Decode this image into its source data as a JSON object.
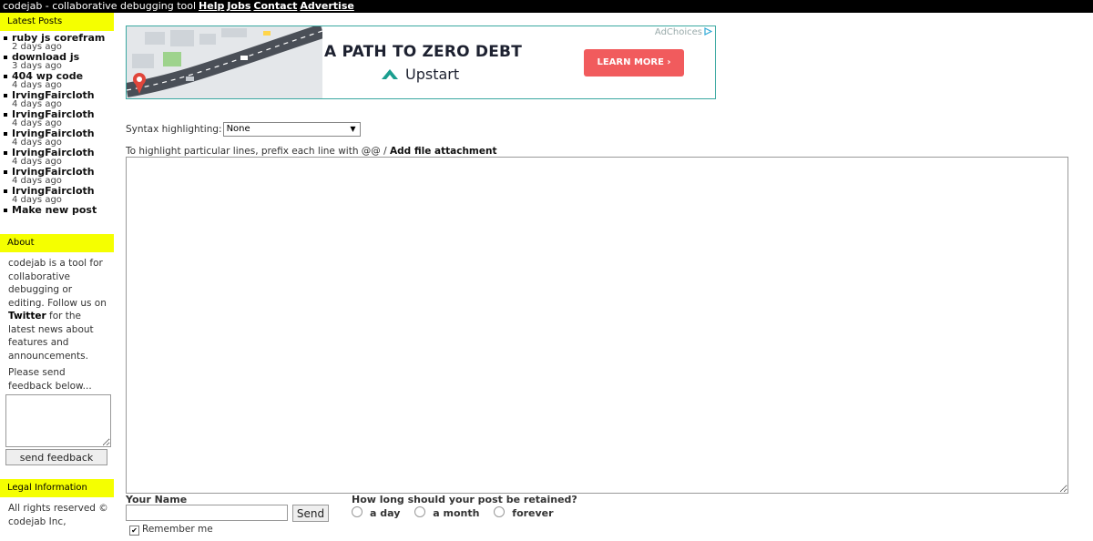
{
  "topbar": {
    "site_title": "codejab - collaborative debugging tool",
    "nav": [
      "Help",
      "Jobs",
      "Contact",
      "Advertise"
    ]
  },
  "sidebar": {
    "latest_heading": "Latest Posts",
    "posts": [
      {
        "title": "ruby js corefram",
        "age": "2 days ago"
      },
      {
        "title": "download js",
        "age": "3 days ago"
      },
      {
        "title": "404 wp code",
        "age": "4 days ago"
      },
      {
        "title": "IrvingFaircloth",
        "age": "4 days ago"
      },
      {
        "title": "IrvingFaircloth",
        "age": "4 days ago"
      },
      {
        "title": "IrvingFaircloth",
        "age": "4 days ago"
      },
      {
        "title": "IrvingFaircloth",
        "age": "4 days ago"
      },
      {
        "title": "IrvingFaircloth",
        "age": "4 days ago"
      },
      {
        "title": "IrvingFaircloth",
        "age": "4 days ago"
      }
    ],
    "make_new_post": "Make new post",
    "about_heading": "About",
    "about_text_1": "codejab is a tool for collaborative debugging or editing. Follow us on",
    "about_twitter": "Twitter",
    "about_text_2": "for the latest news about features and announcements.",
    "feedback_prompt": "Please send feedback below...",
    "feedback_value": "",
    "feedback_button": "send feedback",
    "legal_heading": "Legal Information",
    "legal_text": "All rights reserved © codejab Inc,"
  },
  "ad": {
    "adchoices": "AdChoices",
    "headline": "A PATH TO ZERO DEBT",
    "brand": "Upstart",
    "cta": "LEARN MORE ›",
    "colors": {
      "cta": "#f15b5d",
      "brand_mark": "#1a9e8f",
      "border": "#3aa8a1"
    }
  },
  "form": {
    "syntax_label": "Syntax highlighting:",
    "syntax_value": "None",
    "hint_text": "To highlight particular lines, prefix each line with @@ /",
    "attach_link": "Add file attachment",
    "code_value": "",
    "name_label": "Your Name",
    "name_value": "",
    "send_button": "Send",
    "remember_label": "Remember me",
    "remember_checked": true,
    "retain_label": "How long should your post be retained?",
    "retain_options": [
      "a day",
      "a month",
      "forever"
    ]
  },
  "colors": {
    "sidebar_heading_bg": "#f5ff00",
    "topbar_bg": "#000000"
  }
}
